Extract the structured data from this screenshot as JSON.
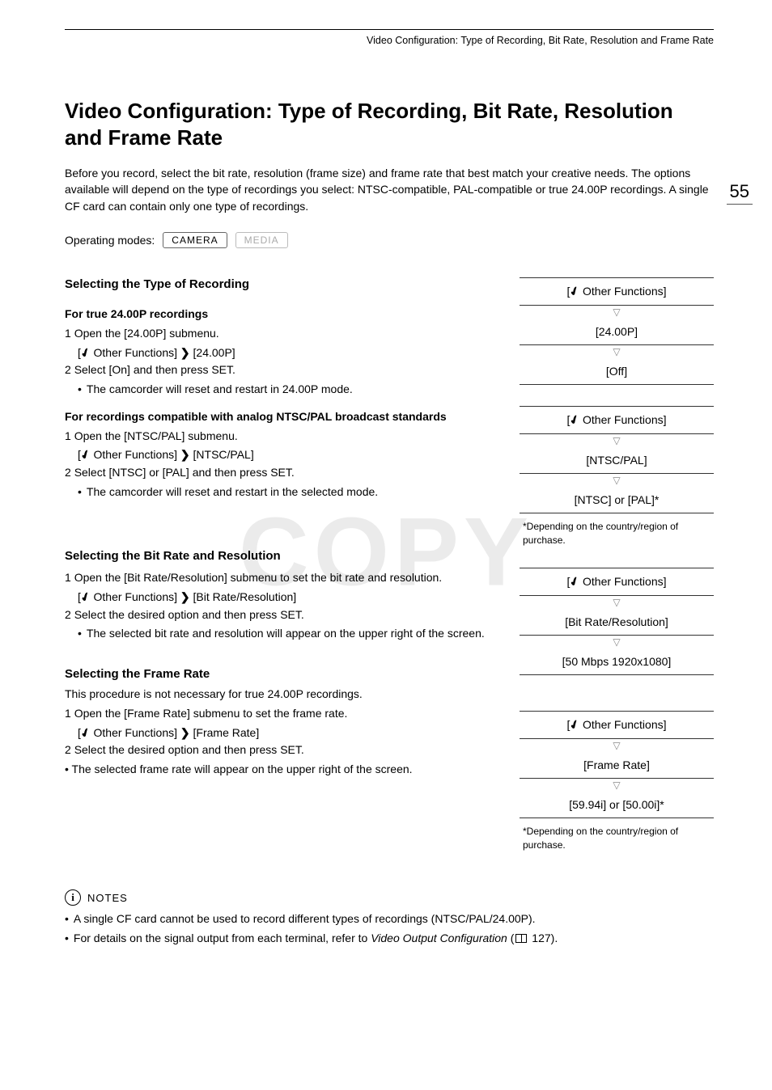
{
  "header": "Video Configuration: Type of Recording, Bit Rate, Resolution and Frame Rate",
  "page_number": "55",
  "title": "Video Configuration: Type of Recording, Bit Rate, Resolution and Frame Rate",
  "intro": "Before you record, select the bit rate, resolution (frame size) and frame rate that best match your creative needs. The options available will depend on the type of recordings you select: NTSC-compatible, PAL-compatible or true 24.00P recordings. A single CF card can contain only one type of recordings.",
  "operating_modes_label": "Operating modes:",
  "mode_camera": "CAMERA",
  "mode_media": "MEDIA",
  "wrench_glyph": "✔",
  "chevron_glyph": "❯",
  "sec1": {
    "heading": "Selecting the Type of Recording",
    "sub1": "For true 24.00P recordings",
    "s1_step1_num": "1",
    "s1_step1": "Open the [24.00P] submenu.",
    "s1_path_prefix": "[",
    "s1_path_a": " Other Functions] ",
    "s1_path_b": " [24.00P]",
    "s1_step2_num": "2",
    "s1_step2": "Select [On] and then press SET.",
    "s1_bullet": "The camcorder will reset and restart in 24.00P mode.",
    "sub2": "For recordings compatible with analog NTSC/PAL broadcast standards",
    "s2_step1_num": "1",
    "s2_step1": "Open the [NTSC/PAL] submenu.",
    "s2_path_b": " [NTSC/PAL]",
    "s2_step2_num": "2",
    "s2_step2": "Select [NTSC] or [PAL] and then press SET.",
    "s2_bullet": "The camcorder will reset and restart in the selected mode."
  },
  "sec2": {
    "heading": "Selecting the Bit Rate and Resolution",
    "step1_num": "1",
    "step1": "Open the [Bit Rate/Resolution] submenu to set the bit rate and resolution.",
    "path_b": " [Bit Rate/Resolution]",
    "step2_num": "2",
    "step2": "Select the desired option and then press SET.",
    "bullet": "The selected bit rate and resolution will appear on the upper right of the screen."
  },
  "sec3": {
    "heading": "Selecting the Frame Rate",
    "intro": "This procedure is not necessary for true 24.00P recordings.",
    "step1_num": "1",
    "step1": "Open the [Frame Rate] submenu to set the frame rate.",
    "path_b": " [Frame Rate]",
    "step2_num": "2",
    "step2": "Select the desired option and then press SET.",
    "tail_bullet": "The selected frame rate will appear on the upper right of the screen."
  },
  "right": {
    "other_functions": " Other Functions]",
    "g1_a": "[24.00P]",
    "g1_b": "[Off]",
    "g2_a": "[NTSC/PAL]",
    "g2_b": "[NTSC] or [PAL]*",
    "g2_note": "*Depending on the country/region of purchase.",
    "g3_a": "[Bit Rate/Resolution]",
    "g3_b": "[50 Mbps 1920x1080]",
    "g4_a": "[Frame Rate]",
    "g4_b": "[59.94i] or [50.00i]*",
    "g4_note": "*Depending on the country/region of purchase."
  },
  "notes": {
    "label": "NOTES",
    "info_glyph": "i",
    "n1": "A single CF card cannot be used to record different types of recordings (NTSC/PAL/24.00P).",
    "n2_a": "For details on the signal output from each terminal, refer to ",
    "n2_italic": "Video Output Configuration",
    "n2_b": " (",
    "n2_page": " 127).",
    "bullet_glyph": "•"
  },
  "watermark": "COPY"
}
